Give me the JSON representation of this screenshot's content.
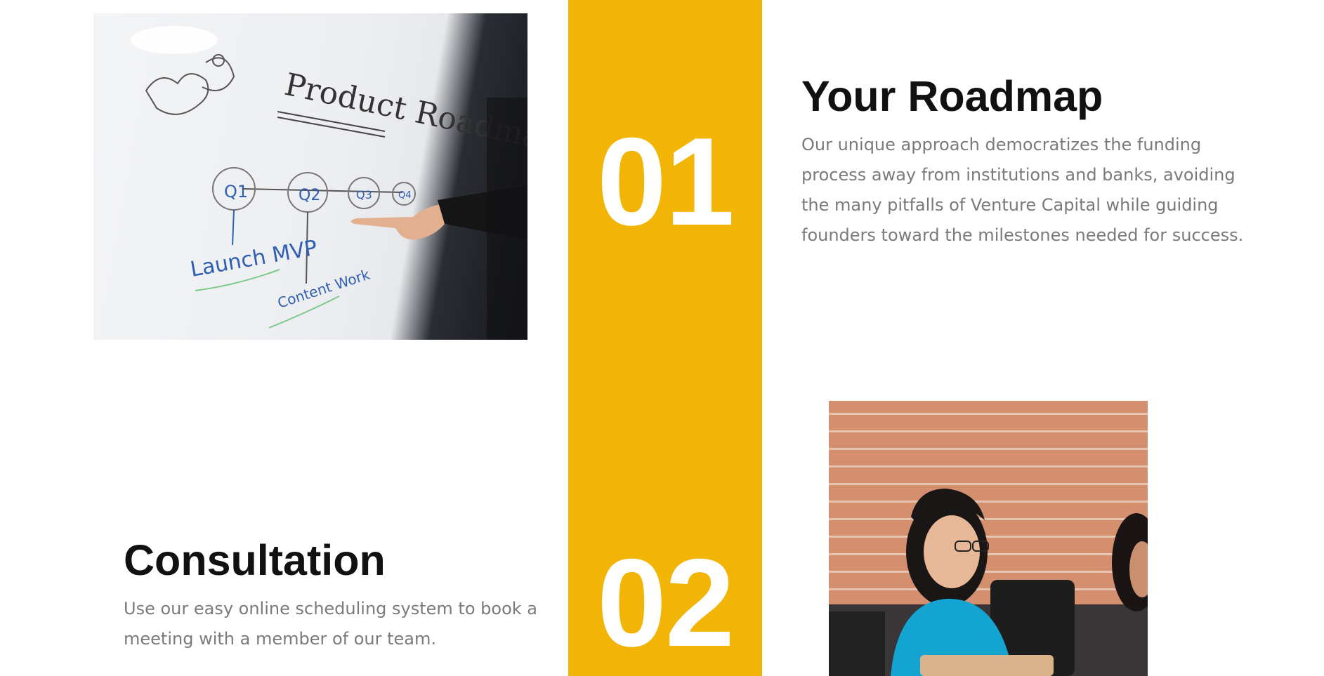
{
  "steps": [
    {
      "number": "01",
      "title": "Your Roadmap",
      "description": "Our unique approach democratizes the funding process away from institutions and banks, avoiding the many pitfalls of Venture Capital while guiding founders toward the milestones needed for success."
    },
    {
      "number": "02",
      "title": "Consultation",
      "description": "Use our easy online scheduling system to book a meeting with a member of our team."
    }
  ],
  "whiteboard": {
    "title": "Product Roadmap",
    "milestones": [
      "Q1",
      "Q2",
      "Q3",
      "Q4"
    ],
    "notes": [
      "Launch MVP",
      "Content Work"
    ]
  },
  "colors": {
    "accent": "#f2b405",
    "heading": "#111111",
    "body_text": "#7a7a7a",
    "number_text": "#ffffff"
  }
}
